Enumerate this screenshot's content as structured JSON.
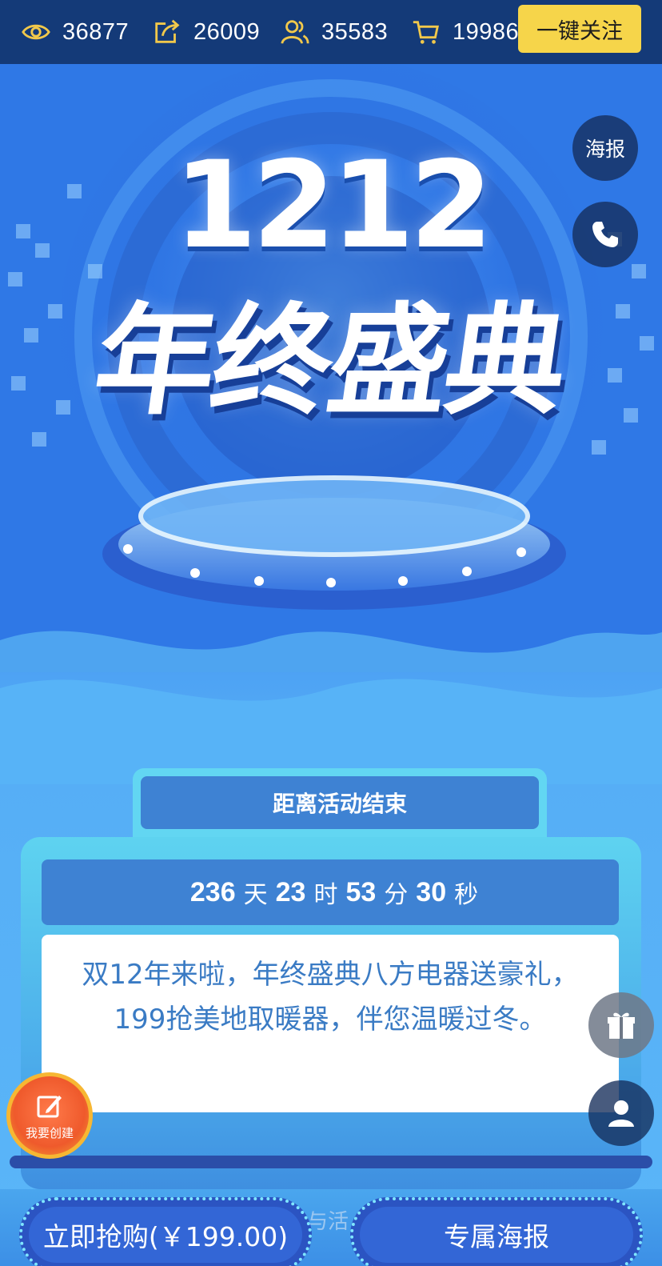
{
  "stats": {
    "views": "36877",
    "shares": "26009",
    "participants": "35583",
    "orders": "19986"
  },
  "follow_button": "一键关注",
  "hero": {
    "number": "1212",
    "title": "年终盛典"
  },
  "side_buttons": {
    "poster": "海报"
  },
  "countdown": {
    "heading": "距离活动结束",
    "days": "236",
    "days_unit": "天",
    "hours": "23",
    "hours_unit": "时",
    "minutes": "53",
    "minutes_unit": "分",
    "seconds": "30",
    "seconds_unit": "秒"
  },
  "description": "双12年来啦，年终盛典八方电器送豪礼，199抢美地取暖器，伴您温暖过冬。",
  "create_badge": "我要创建",
  "peek_text": "与活",
  "bottom": {
    "buy_label": "立即抢购(￥199.00)",
    "poster_label": "专属海报"
  },
  "colors": {
    "topbar": "#143a78",
    "follow": "#f6d54a",
    "accent_blue": "#3e82d3",
    "text_blue": "#3a7bc4"
  }
}
